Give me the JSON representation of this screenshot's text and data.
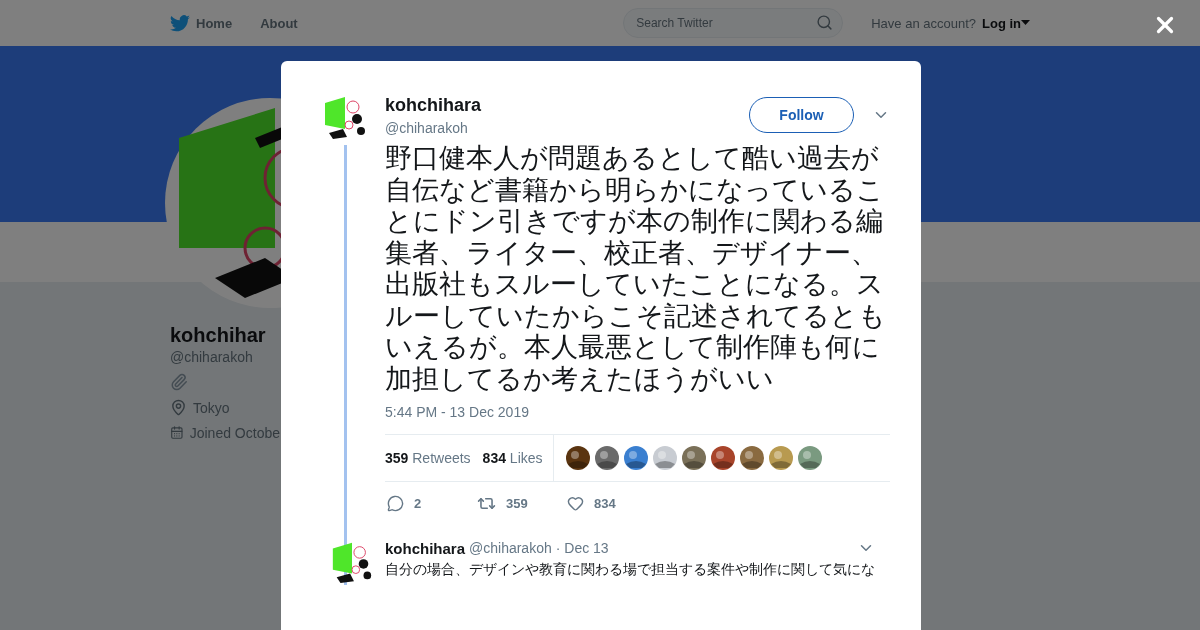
{
  "nav": {
    "items": [
      {
        "label": "Home"
      },
      {
        "label": "About"
      }
    ],
    "search": {
      "placeholder": "Search Twitter"
    },
    "account_prompt": "Have an account?",
    "login": "Log in"
  },
  "profile": {
    "name": "kohchihar",
    "handle": "@chiharakoh",
    "location": "Tokyo",
    "joined": "Joined Octobe"
  },
  "tweet": {
    "name": "kohchihara",
    "handle": "@chiharakoh",
    "follow": "Follow",
    "text": "野口健本人が問題あるとして酷い過去が自伝など書籍から明らかになっていることにドン引きですが本の制作に関わる編集者、ライター、校正者、デザイナー、出版社もスルーしていたことになる。スルーしていたからこそ記述されてるともいえるが。本人最悪として制作陣も何に加担してるか考えたほうがいい",
    "time": "5:44 PM - 13 Dec 2019",
    "stats": [
      {
        "count": "359",
        "label": "Retweets"
      },
      {
        "count": "834",
        "label": "Likes"
      }
    ],
    "likers": [
      {
        "color": "#5a3410"
      },
      {
        "color": "#6a6a6a"
      },
      {
        "color": "#3a7fd0"
      },
      {
        "color": "#c8ccd2"
      },
      {
        "color": "#7a7058"
      },
      {
        "color": "#a8442a"
      },
      {
        "color": "#8a6a40"
      },
      {
        "color": "#b89a50"
      },
      {
        "color": "#7a9a80"
      }
    ],
    "actions": [
      {
        "kind": "reply",
        "count": "2"
      },
      {
        "kind": "retweet",
        "count": "359"
      },
      {
        "kind": "like",
        "count": "834"
      }
    ]
  },
  "reply": {
    "name": "kohchihara",
    "handle": "@chiharakoh",
    "date": "· Dec 13",
    "text": "自分の場合、デザインや教育に関わる場で担当する案件や制作に関して気にな"
  }
}
